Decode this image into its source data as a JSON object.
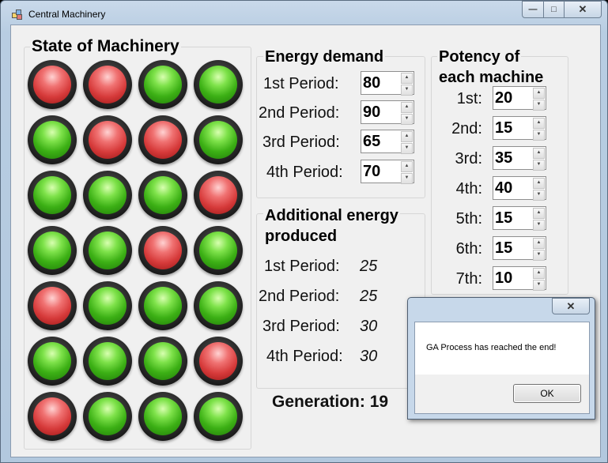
{
  "window": {
    "title": "Central Machinery",
    "minimize": "—",
    "maximize": "□",
    "close": "✕"
  },
  "state": {
    "title": "State of Machinery",
    "lamps": [
      [
        "off",
        "off",
        "on",
        "on"
      ],
      [
        "on",
        "off",
        "off",
        "on"
      ],
      [
        "on",
        "on",
        "on",
        "off"
      ],
      [
        "on",
        "on",
        "off",
        "on"
      ],
      [
        "off",
        "on",
        "on",
        "on"
      ],
      [
        "on",
        "on",
        "on",
        "off"
      ],
      [
        "off",
        "on",
        "on",
        "on"
      ]
    ]
  },
  "energy_demand": {
    "title": "Energy demand",
    "periods": [
      {
        "label": "1st Period:",
        "value": "80"
      },
      {
        "label": "2nd Period:",
        "value": "90"
      },
      {
        "label": "3rd Period:",
        "value": "65"
      },
      {
        "label": "4th Period:",
        "value": "70"
      }
    ]
  },
  "additional": {
    "title_line1": "Additional energy",
    "title_line2": "produced",
    "periods": [
      {
        "label": "1st Period:",
        "value": "25"
      },
      {
        "label": "2nd Period:",
        "value": "25"
      },
      {
        "label": "3rd Period:",
        "value": "30"
      },
      {
        "label": "4th Period:",
        "value": "30"
      }
    ]
  },
  "potency": {
    "title_line1": "Potency of",
    "title_line2": "each machine",
    "machines": [
      {
        "label": "1st:",
        "value": "20"
      },
      {
        "label": "2nd:",
        "value": "15"
      },
      {
        "label": "3rd:",
        "value": "35"
      },
      {
        "label": "4th:",
        "value": "40"
      },
      {
        "label": "5th:",
        "value": "15"
      },
      {
        "label": "6th:",
        "value": "15"
      },
      {
        "label": "7th:",
        "value": "10"
      }
    ]
  },
  "generation": {
    "label": "Generation:",
    "value": "19"
  },
  "dialog": {
    "close": "✕",
    "message": "GA Process has reached the end!",
    "ok_label": "OK"
  },
  "colors": {
    "lamp_on": "#3cb015",
    "lamp_off": "#d63a3a",
    "window_frame": "#b8cde2"
  }
}
